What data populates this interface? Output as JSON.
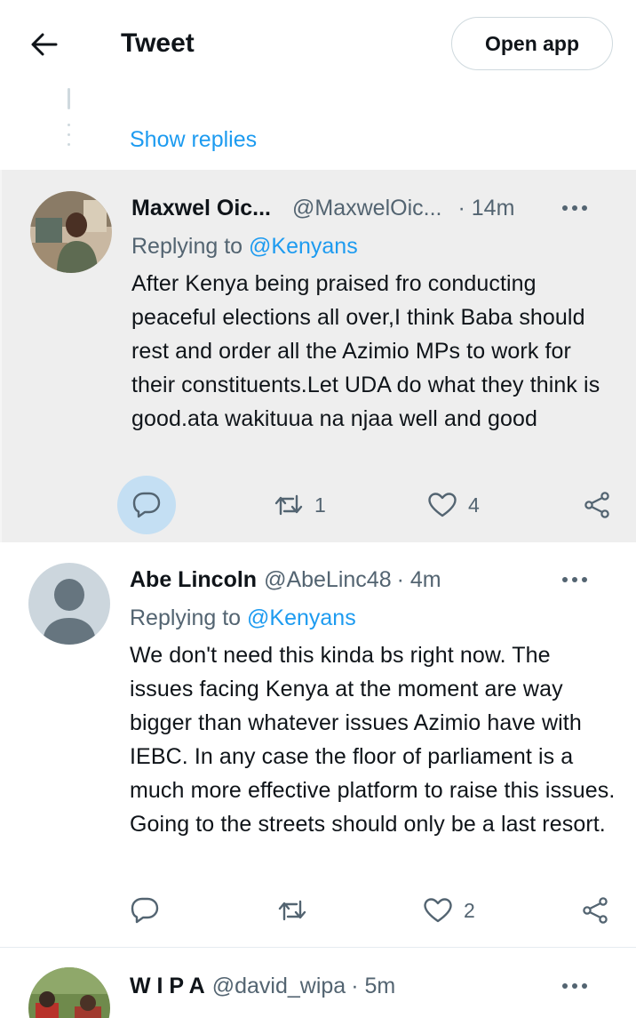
{
  "header": {
    "title": "Tweet",
    "open_app_label": "Open app"
  },
  "thread": {
    "show_replies_label": "Show replies"
  },
  "tweets": [
    {
      "name": "Maxwel Oic...",
      "handle": "@MaxwelOic...",
      "time": "· 14m",
      "replying_prefix": "Replying to ",
      "replying_to": "@Kenyans",
      "text": "After Kenya being praised fro conducting peaceful elections all over,I think Baba should rest and order all the Azimio MPs to work for their constituents.Let UDA do what they think is good.ata wakituua na njaa well and good",
      "retweets": "1",
      "likes": "4"
    },
    {
      "name": "Abe Lincoln",
      "handle": "@AbeLinc48",
      "time": "· 4m",
      "replying_prefix": "Replying to ",
      "replying_to": "@Kenyans",
      "text": "We don't need this kinda bs right now. The issues facing Kenya at the moment are way bigger than whatever issues Azimio have with IEBC. In any case the floor of parliament is a much more effective platform to raise this issues. Going to the streets should only be a last resort.",
      "retweets": "",
      "likes": "2"
    },
    {
      "name": "W I P A",
      "handle": "@david_wipa",
      "time": "· 5m"
    }
  ],
  "colors": {
    "accent": "#1d9bf0",
    "secondary_text": "#536471",
    "highlight_bg": "#eeeeee",
    "reply_bubble": "#c4dff3"
  },
  "icons": {
    "back": "arrow-left-icon",
    "more": "more-horizontal-icon",
    "reply": "reply-icon",
    "retweet": "retweet-icon",
    "like": "heart-icon",
    "share": "share-icon"
  }
}
